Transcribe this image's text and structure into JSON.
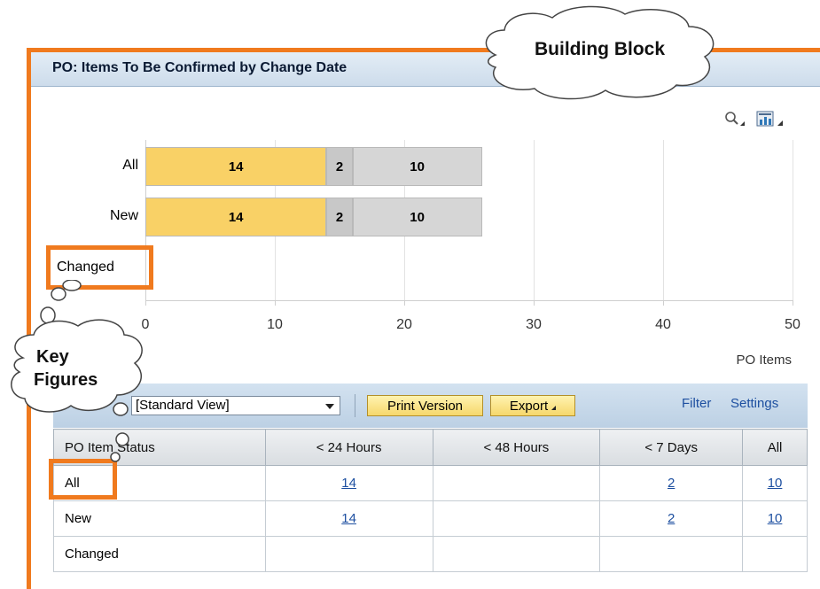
{
  "panel": {
    "title": "PO: Items To Be Confirmed by Change Date"
  },
  "callouts": {
    "building_block": "Building Block",
    "key_figures_line1": "Key",
    "key_figures_line2": "Figures"
  },
  "toolbar_icons": [
    "zoom-icon",
    "chart-type-icon"
  ],
  "chart_data": {
    "type": "bar",
    "orientation": "horizontal",
    "stacked": true,
    "categories": [
      "All",
      "New",
      "Changed"
    ],
    "series": [
      {
        "values": [
          14,
          14,
          0
        ],
        "color": "#f9d166"
      },
      {
        "values": [
          2,
          2,
          0
        ],
        "color": "#c8c8c8"
      },
      {
        "values": [
          10,
          10,
          0
        ],
        "color": "#d6d6d6"
      }
    ],
    "x_ticks": [
      "0",
      "10",
      "20",
      "30",
      "40",
      "50"
    ],
    "xlim": [
      0,
      50
    ],
    "xlabel": "PO Items",
    "grid": true
  },
  "toolbar": {
    "view_select": "[Standard View]",
    "print_label": "Print Version",
    "export_label": "Export",
    "filter_label": "Filter",
    "settings_label": "Settings"
  },
  "table": {
    "columns": [
      "PO Item Status",
      "< 24 Hours",
      "< 48 Hours",
      "< 7 Days",
      "All"
    ],
    "rows": [
      [
        "All",
        "14",
        "",
        "2",
        "10"
      ],
      [
        "New",
        "14",
        "",
        "2",
        "10"
      ],
      [
        "Changed",
        "",
        "",
        "",
        ""
      ]
    ]
  },
  "colors": {
    "highlight": "#f07a1e",
    "header": "#cddceb",
    "bar_yellow": "#f9d166",
    "bar_gray": "#d6d6d6"
  }
}
